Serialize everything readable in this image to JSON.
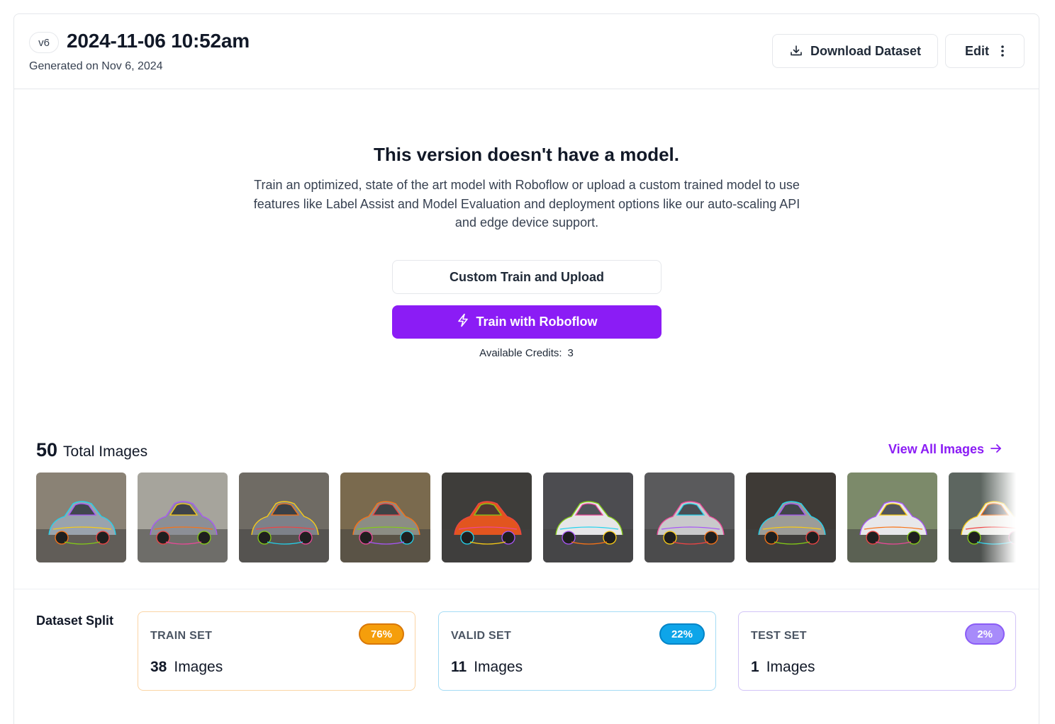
{
  "header": {
    "version_badge": "v6",
    "title": "2024-11-06 10:52am",
    "generated": "Generated on Nov 6, 2024",
    "download_label": "Download Dataset",
    "edit_label": "Edit"
  },
  "empty_state": {
    "title": "This version doesn't have a model.",
    "description": "Train an optimized, state of the art model with Roboflow or upload a custom trained model to use features like Label Assist and Model Evaluation and deployment options like our auto-scaling API and edge device support.",
    "custom_button": "Custom Train and Upload",
    "train_button": "Train with Roboflow",
    "credits_label": "Available Credits:",
    "credits_value": "3"
  },
  "images": {
    "total_count": "50",
    "total_label": "Total Images",
    "view_all": "View All Images",
    "thumbnails": [
      {
        "body": "#9aa3ad",
        "bg": "#8a8275"
      },
      {
        "body": "#8c8f96",
        "bg": "#a6a49c"
      },
      {
        "body": "#7d8189",
        "bg": "#6f6b64"
      },
      {
        "body": "#8c8d84",
        "bg": "#7a6a4e"
      },
      {
        "body": "#e2551f",
        "bg": "#3e3d3a"
      },
      {
        "body": "#e6e6e8",
        "bg": "#4c4c50"
      },
      {
        "body": "#c9c9cb",
        "bg": "#5a5a5c"
      },
      {
        "body": "#9c9c98",
        "bg": "#3e3a36"
      },
      {
        "body": "#e8e8ea",
        "bg": "#7c8a6a"
      },
      {
        "body": "#ecebe6",
        "bg": "#5d6660"
      }
    ]
  },
  "split": {
    "label": "Dataset Split",
    "train": {
      "name": "TRAIN SET",
      "pct": "76%",
      "count": "38",
      "unit": "Images"
    },
    "valid": {
      "name": "VALID SET",
      "pct": "22%",
      "count": "11",
      "unit": "Images"
    },
    "test": {
      "name": "TEST SET",
      "pct": "2%",
      "count": "1",
      "unit": "Images"
    }
  },
  "colors": {
    "accent": "#8b1cf5",
    "train_badge": "#f59e0b",
    "valid_badge": "#0ea5e9",
    "test_badge": "#a78bfa"
  }
}
